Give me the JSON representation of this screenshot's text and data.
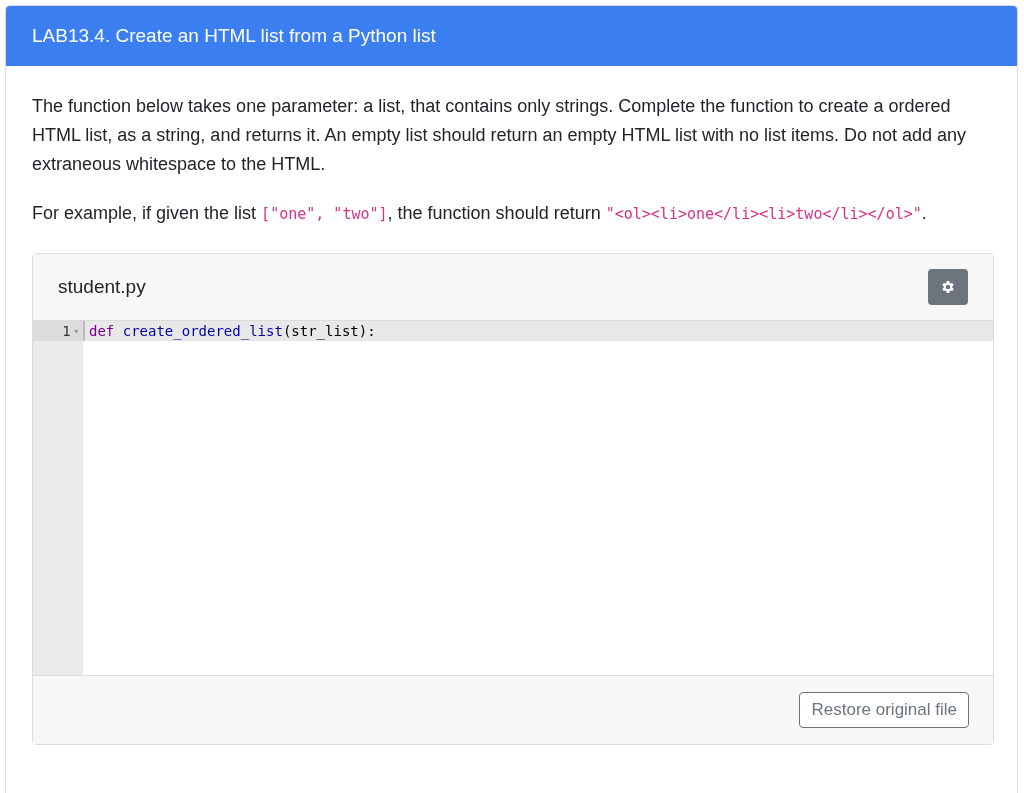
{
  "card": {
    "title": "LAB13.4. Create an HTML list from a Python list"
  },
  "paragraphs": [
    {
      "segments": [
        {
          "kind": "text",
          "text": "The function below takes one parameter: a list, that contains only strings. Complete the function to create a ordered HTML list, as a string, and returns it. An empty list should return an empty HTML list with no list items. Do not add any extraneous whitespace to the HTML."
        }
      ]
    },
    {
      "segments": [
        {
          "kind": "text",
          "text": "For example, if given the list "
        },
        {
          "kind": "code",
          "text": "[\"one\", \"two\"]"
        },
        {
          "kind": "text",
          "text": ", the function should return "
        },
        {
          "kind": "code",
          "text": "\"<ol><li>one</li><li>two</li></ol>\""
        },
        {
          "kind": "text",
          "text": "."
        }
      ]
    }
  ],
  "editor": {
    "filename": "student.py",
    "lines": [
      {
        "number": "1",
        "fold": "▾",
        "tokens": [
          {
            "kind": "keyword",
            "text": "def"
          },
          {
            "kind": "function",
            "text": "create_ordered_list"
          },
          {
            "kind": "plain",
            "text": "(str_list):"
          }
        ]
      }
    ],
    "button": "Restore original file"
  }
}
